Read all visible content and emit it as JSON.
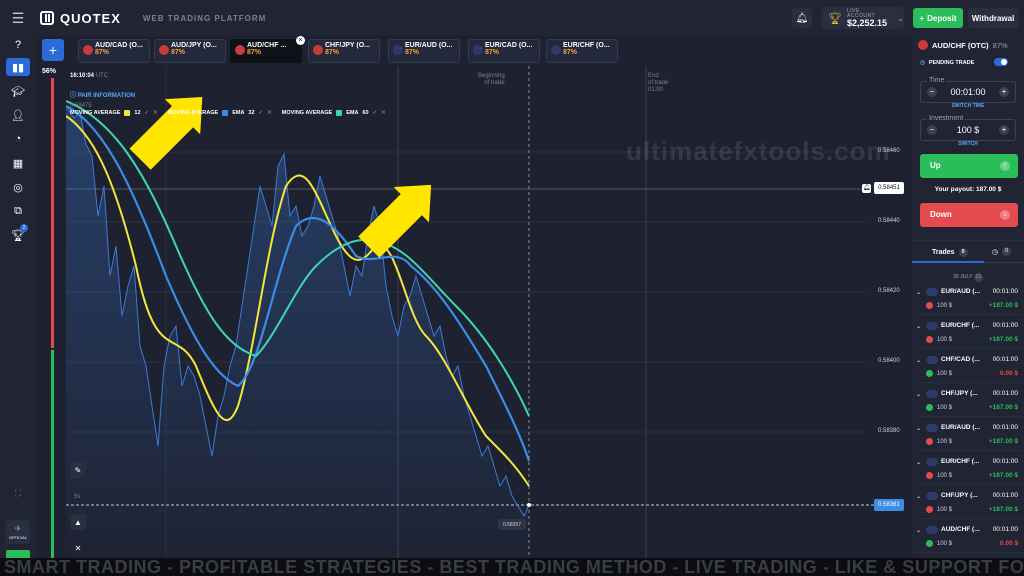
{
  "header": {
    "logo": "QUOTEX",
    "platform": "WEB TRADING PLATFORM",
    "account_label": "LIVE ACCOUNT",
    "balance": "$2,252.15",
    "deposit": "Deposit",
    "withdrawal": "Withdrawal"
  },
  "sidebar": {
    "percent": "56%",
    "official": "OFFICIAL",
    "notif_count": "2"
  },
  "tabs": [
    {
      "name": "AUD/CAD (O...",
      "pct": "87%"
    },
    {
      "name": "AUD/JPY (O...",
      "pct": "87%"
    },
    {
      "name": "AUD/CHF ...",
      "pct": "87%"
    },
    {
      "name": "CHF/JPY (O...",
      "pct": "87%"
    },
    {
      "name": "EUR/AUD (O...",
      "pct": "87%"
    },
    {
      "name": "EUR/CAD (O...",
      "pct": "87%"
    },
    {
      "name": "EUR/CHF (O...",
      "pct": "87%"
    }
  ],
  "chart": {
    "time": "16:10:04",
    "tz": "UTC",
    "pair_info": "PAIR INFORMATION",
    "watermark": "ultimatefxtools.com",
    "indicators": [
      {
        "name": "MOVING AVERAGE",
        "type": "",
        "period": "12",
        "color": "#f5e63a"
      },
      {
        "name": "MOVING AVERAGE",
        "type": "EMA",
        "period": "32",
        "color": "#3c8ce6"
      },
      {
        "name": "MOVING AVERAGE",
        "type": "EMA",
        "period": "60",
        "color": "#3ed6b0"
      }
    ],
    "prices": [
      "0.58460",
      "0.58440",
      "0.58420",
      "0.58400",
      "0.58380"
    ],
    "current_price": "0.58451",
    "live_price": "0.58361",
    "mini_price": "0.58357",
    "beginning": [
      "Beginning",
      "of trade"
    ],
    "end": [
      "End",
      "of trade",
      "01:00"
    ],
    "timeframe": "5s",
    "top_price": "0.58475"
  },
  "panel": {
    "pair": "AUD/CHF (OTC)",
    "pair_pct": "87%",
    "pending": "PENDING TRADE",
    "time_label": "Time",
    "time_value": "00:01:00",
    "switch_time": "SWITCH TIME",
    "investment_label": "Investment",
    "investment_value": "100 $",
    "switch": "SWITCH",
    "up": "Up",
    "payout": "Your payout: 187.00 $",
    "down": "Down"
  },
  "trades": {
    "tab": "Trades",
    "count": "0",
    "date": "30 JULY",
    "date_count": "13",
    "rows": [
      {
        "pair": "EUR/AUD (...",
        "time": "00:01:00",
        "amount": "100 $",
        "payout": "+187.00 $",
        "win": true,
        "dir": "down"
      },
      {
        "pair": "EUR/CHF (...",
        "time": "00:01:00",
        "amount": "100 $",
        "payout": "+187.00 $",
        "win": true,
        "dir": "down"
      },
      {
        "pair": "CHF/CAD (...",
        "time": "00:01:00",
        "amount": "100 $",
        "payout": "0.00 $",
        "win": false,
        "dir": "up"
      },
      {
        "pair": "CHF/JPY (...",
        "time": "00:01:00",
        "amount": "100 $",
        "payout": "+187.00 $",
        "win": true,
        "dir": "up"
      },
      {
        "pair": "EUR/AUD (...",
        "time": "00:01:00",
        "amount": "100 $",
        "payout": "+187.00 $",
        "win": true,
        "dir": "down"
      },
      {
        "pair": "EUR/CHF (...",
        "time": "00:01:00",
        "amount": "100 $",
        "payout": "+187.00 $",
        "win": true,
        "dir": "down"
      },
      {
        "pair": "CHF/JPY (...",
        "time": "00:01:00",
        "amount": "100 $",
        "payout": "+187.00 $",
        "win": true,
        "dir": "down"
      },
      {
        "pair": "AUD/CHF (...",
        "time": "00:01:00",
        "amount": "100 $",
        "payout": "0.00 $",
        "win": false,
        "dir": "up"
      }
    ]
  },
  "banner": "SMART TRADING - PROFITABLE STRATEGIES - BEST TRADING METHOD - LIVE TRADING - LIKE & SUPPORT FOR MORE FREE STRATEGIES"
}
